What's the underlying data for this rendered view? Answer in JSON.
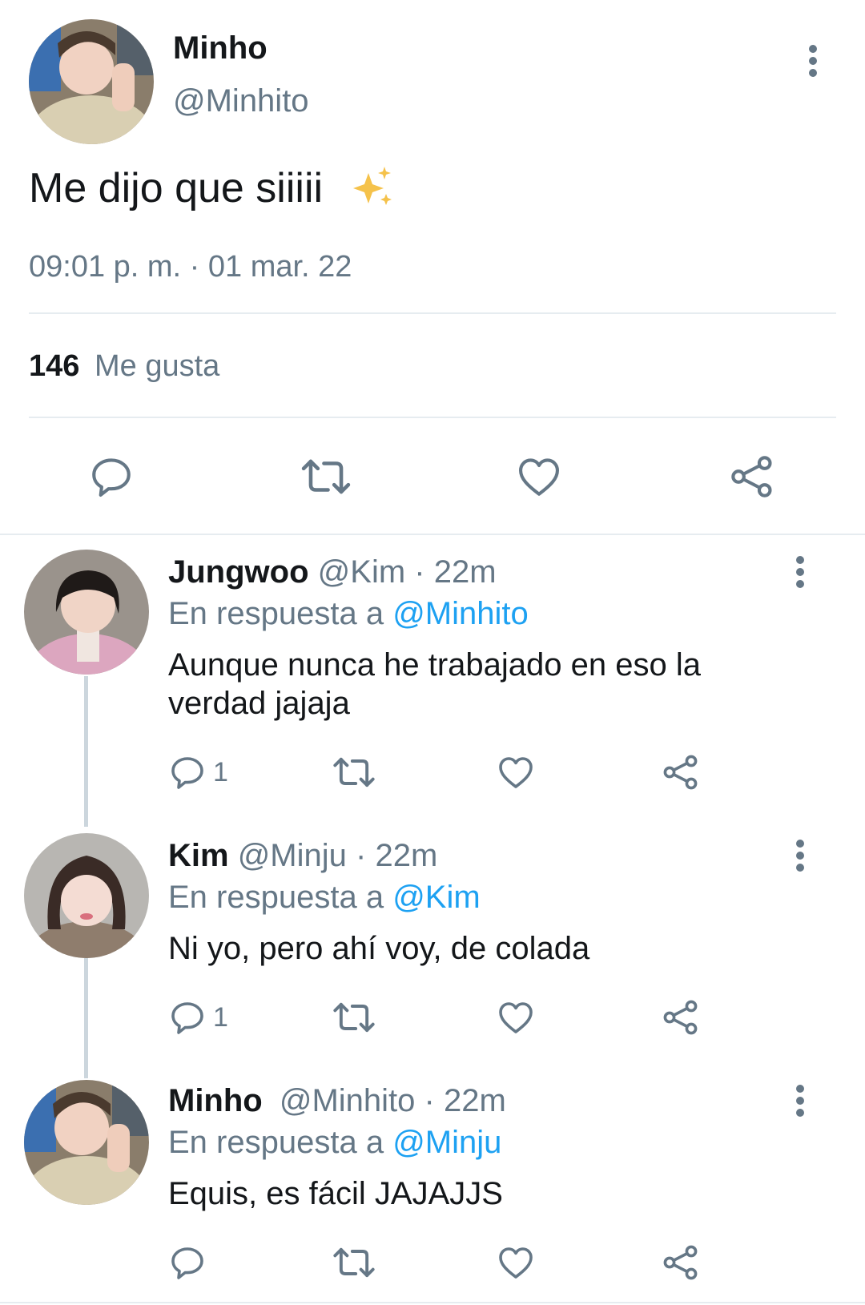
{
  "tweet": {
    "author_name": "Minho",
    "author_handle": "@Minhito",
    "text": "Me dijo que siiiii",
    "emoji": "✨",
    "timestamp": "09:01 p. m. · 01 mar. 22",
    "likes_count": "146",
    "likes_label": "Me gusta"
  },
  "replies": [
    {
      "name": "Jungwoo",
      "handle": "@Kim",
      "time": "· 22m",
      "reply_prefix": "En respuesta a",
      "reply_to": "@Minhito",
      "text": "Aunque nunca he trabajado en eso la verdad jajaja",
      "reply_count": "1"
    },
    {
      "name": "Kim",
      "handle": "@Minju",
      "time": "· 22m",
      "reply_prefix": "En respuesta a",
      "reply_to": "@Kim",
      "text": "Ni yo, pero ahí voy, de colada",
      "reply_count": "1"
    },
    {
      "name": "Minho",
      "handle": "@Minhito",
      "time": "· 22m",
      "reply_prefix": "En respuesta a",
      "reply_to": "@Minju",
      "text": "Equis, es fácil JAJAJJS",
      "reply_count": ""
    }
  ],
  "colors": {
    "text": "#14171a",
    "secondary": "#657786",
    "link": "#1da1f2",
    "divider": "#e6ecf0"
  },
  "icons": [
    "comment-icon",
    "retweet-icon",
    "heart-icon",
    "share-icon",
    "more-vertical-icon"
  ]
}
